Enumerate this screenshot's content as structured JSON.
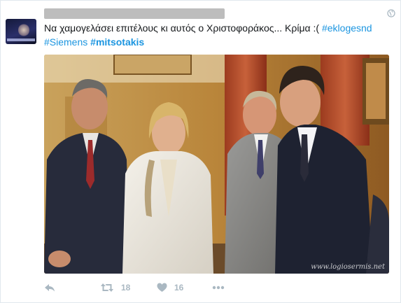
{
  "tweet": {
    "text": "Να χαμογελάσει επιτέλους κι αυτός ο Χριστοφοράκος... Κρίμα :(",
    "hashtags": [
      "#eklogesnd",
      "#Siemens",
      "#mitsotakis"
    ],
    "retweet_count": "18",
    "like_count": "16"
  },
  "media": {
    "watermark": "www.logiosermis.net"
  },
  "icons": {
    "reply": "reply-icon",
    "retweet": "retweet-icon",
    "like": "heart-icon",
    "more": "more-icon",
    "globe": "globe-icon"
  },
  "colors": {
    "text": "#14171a",
    "hashtag": "#1b95e0",
    "action": "#aab8c2",
    "redaction": "#bdbdbd"
  }
}
